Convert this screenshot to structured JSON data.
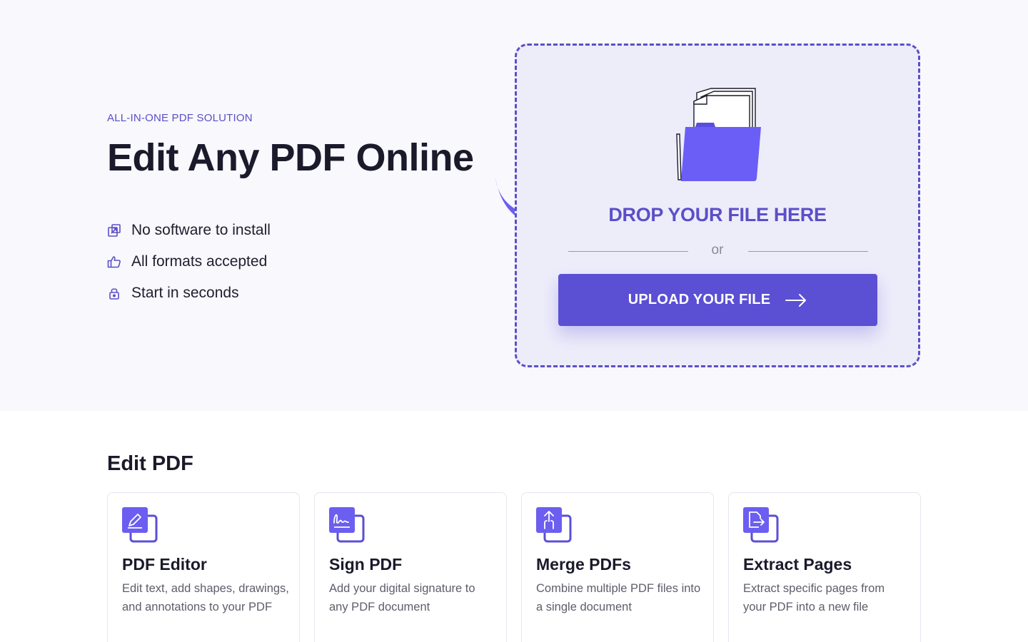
{
  "hero": {
    "eyebrow": "ALL-IN-ONE PDF SOLUTION",
    "headline": "Edit Any PDF Online",
    "features": [
      {
        "icon": "external-link-icon",
        "label": "No software to install"
      },
      {
        "icon": "thumbs-up-icon",
        "label": "All formats accepted"
      },
      {
        "icon": "lock-icon",
        "label": "Start in seconds"
      }
    ]
  },
  "dropzone": {
    "title": "DROP YOUR FILE HERE",
    "or_text": "or",
    "upload_label": "UPLOAD YOUR FILE",
    "upload_icon": "arrow-right-icon",
    "art_icon": "folder-with-documents-icon"
  },
  "edit_section": {
    "title": "Edit PDF",
    "cards": [
      {
        "icon": "pencil-icon",
        "title": "PDF Editor",
        "description": "Edit text, add shapes, drawings, and annotations to your PDF"
      },
      {
        "icon": "signature-icon",
        "title": "Sign PDF",
        "description": "Add your digital signature to any PDF document"
      },
      {
        "icon": "merge-arrow-icon",
        "title": "Merge PDFs",
        "description": "Combine multiple PDF files into a single document"
      },
      {
        "icon": "extract-page-icon",
        "title": "Extract Pages",
        "description": "Extract specific pages from your PDF into a new file"
      }
    ]
  },
  "colors": {
    "accent": "#5b4fd4",
    "accent_text": "#5b4fc7",
    "hero_bg": "#f8f8fd",
    "dropzone_bg": "#ededfa"
  }
}
